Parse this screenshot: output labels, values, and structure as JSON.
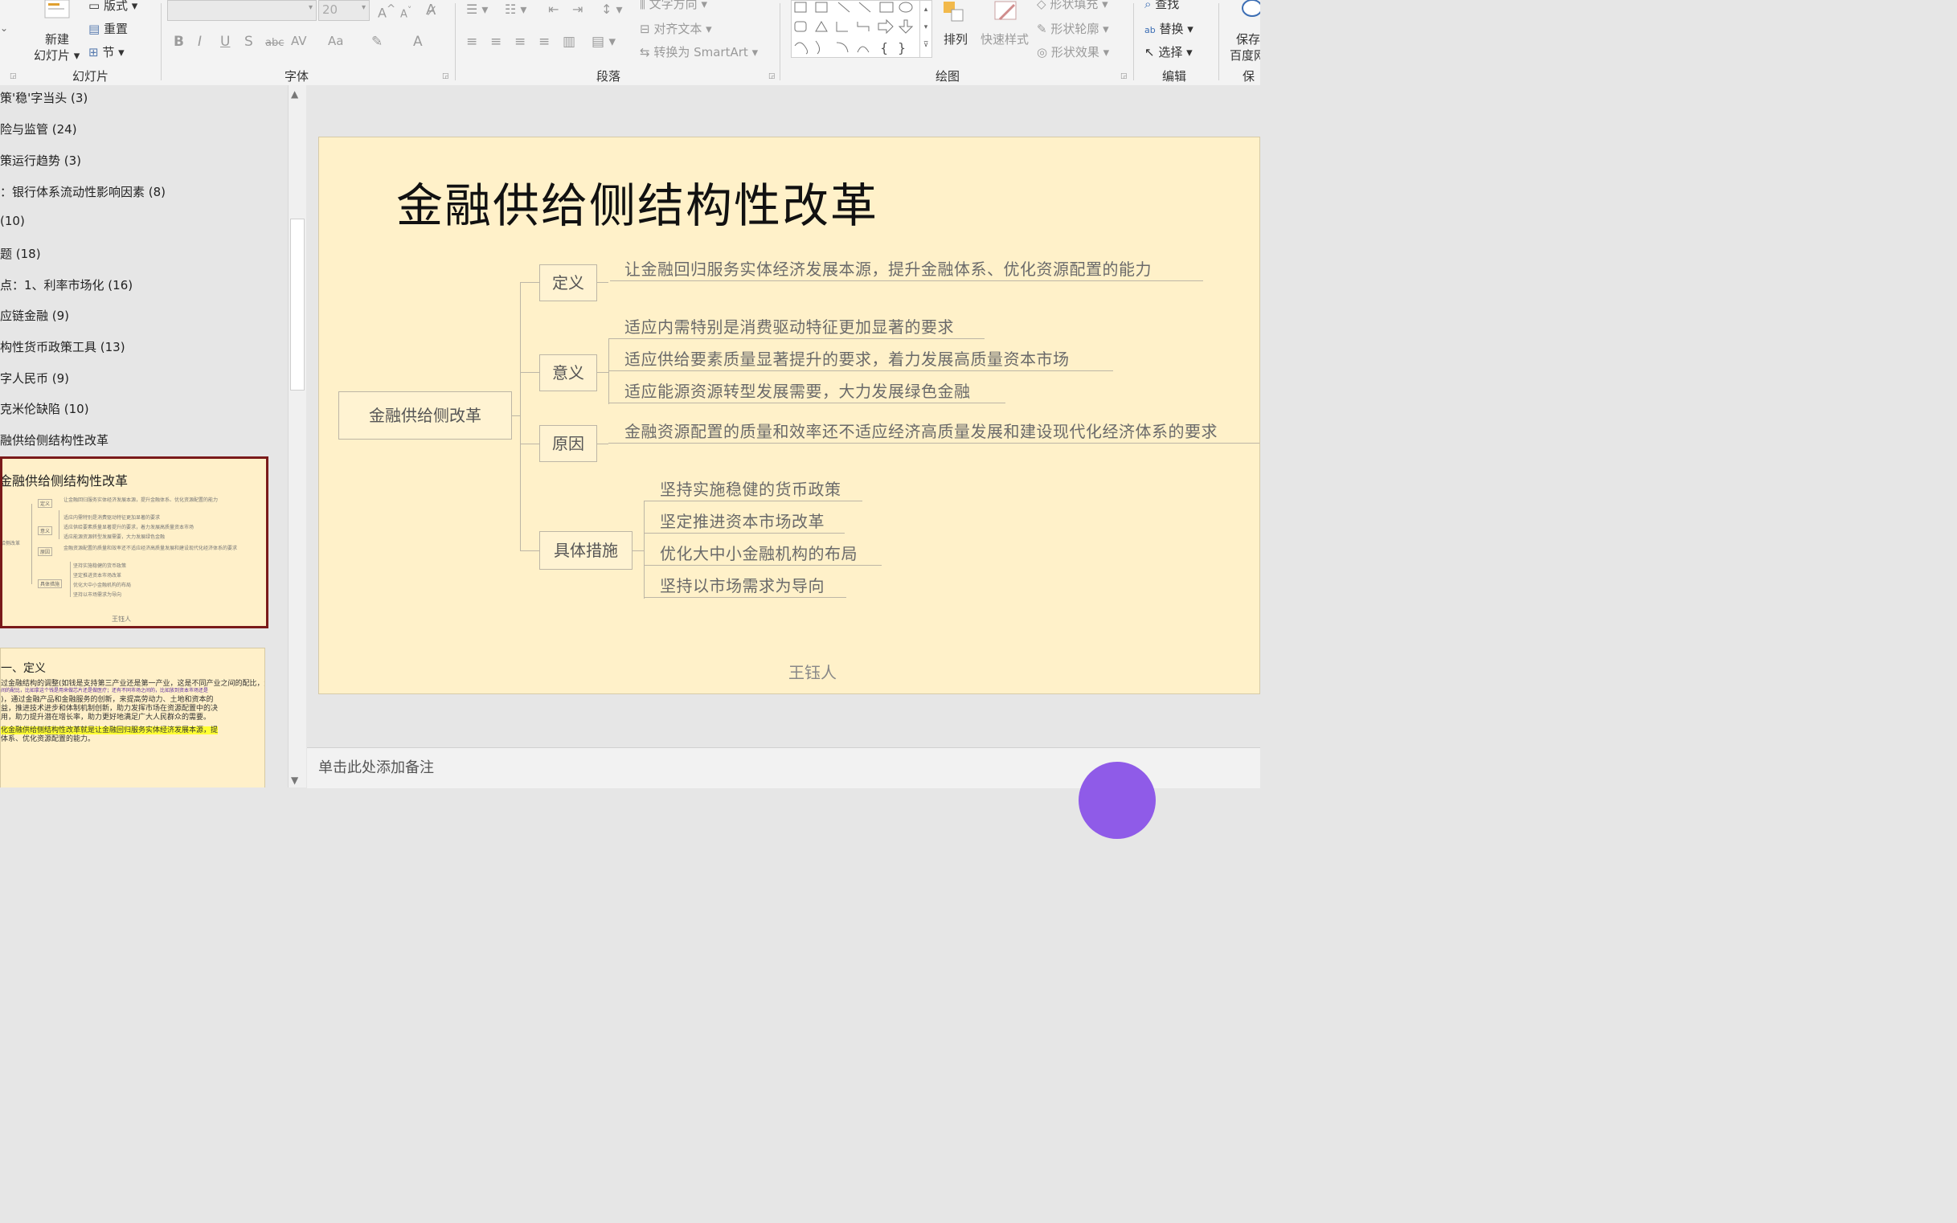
{
  "ribbon": {
    "slides_group": {
      "new_slide": "新建",
      "new_slide_line2": "幻灯片",
      "layout": "版式",
      "reset": "重置",
      "section": "节",
      "label": "幻灯片"
    },
    "font_group": {
      "font_name": "",
      "font_size": "20",
      "label": "字体",
      "buttons": [
        "B",
        "I",
        "U",
        "S",
        "abc",
        "AV",
        "Aa",
        "A"
      ]
    },
    "paragraph_group": {
      "text_direction": "文字方向",
      "align_text": "对齐文本",
      "convert_smartart": "转换为 SmartArt",
      "label": "段落"
    },
    "drawing_group": {
      "arrange": "排列",
      "quick_styles": "快速样式",
      "shape_fill": "形状填充",
      "shape_outline": "形状轮廓",
      "shape_effects": "形状效果",
      "label": "绘图"
    },
    "editing_group": {
      "find": "查找",
      "replace": "替换",
      "select": "选择",
      "label": "编辑"
    },
    "save_group": {
      "save_line1": "保存",
      "save_line2": "百度网",
      "label": "保存"
    }
  },
  "outline": [
    "策'稳'字当头 (3)",
    "险与监管 (24)",
    "策运行趋势 (3)",
    "：银行体系流动性影响因素 (8)",
    " (10)",
    "题 (18)",
    "点：1、利率市场化 (16)",
    "应链金融 (9)",
    "构性货币政策工具 (13)",
    "字人民币 (9)",
    "克米伦缺陷 (10)",
    "融供给侧结构性改革"
  ],
  "thumbnail_selected": {
    "title": "金融供给侧结构性改革",
    "root": "给侧改革",
    "boxes": [
      "定义",
      "意义",
      "原因",
      "具体措施"
    ],
    "lines": [
      "让金融回归服务实体经济发展本源，提升金融体系、优化资源配置的能力",
      "适应内需特别是消费驱动特征更加显著的要求",
      "适应供给要素质量显著提升的要求，着力发展高质量资本市场",
      "适应能源资源转型发展需要，大力发展绿色金融",
      "金融资源配置的质量和效率还不适应经济高质量发展和建设现代化经济体系的要求",
      "坚持实施稳健的货币政策",
      "坚定推进资本市场改革",
      "优化大中小金融机构的布局",
      "坚持以市场需求为导向"
    ],
    "author": "王钰人"
  },
  "thumbnail_next": {
    "title": "一、定义",
    "lines": [
      "过金融结构的调整(如钱是支持第三产业还是第一产业，这是不同产业之间的配比，还有不",
      "间的配比，比如拿这个钱是用来做芯片还是做医疗；还有不同市场之间的，比如放到资本市场还是",
      ")，通过金融产品和金融服务的创新，来提高劳动力、土地和资本的",
      "益，推进技术进步和体制机制创新，助力发挥市场在资源配置中的决",
      "用，助力提升潜在增长率，助力更好地满足广大人民群众的需要。",
      "化金融供给侧结构性改革就是让金融回归服务实体经济发展本源，提",
      "体系、优化资源配置的能力。"
    ]
  },
  "slide": {
    "title": "金融供给侧结构性改革",
    "root": "金融供给侧改革",
    "branches": [
      {
        "label": "定义",
        "items": [
          "让金融回归服务实体经济发展本源，提升金融体系、优化资源配置的能力"
        ]
      },
      {
        "label": "意义",
        "items": [
          "适应内需特别是消费驱动特征更加显著的要求",
          "适应供给要素质量显著提升的要求，着力发展高质量资本市场",
          "适应能源资源转型发展需要，大力发展绿色金融"
        ]
      },
      {
        "label": "原因",
        "items": [
          "金融资源配置的质量和效率还不适应经济高质量发展和建设现代化经济体系的要求"
        ]
      },
      {
        "label": "具体措施",
        "items": [
          "坚持实施稳健的货币政策",
          "坚定推进资本市场改革",
          "优化大中小金融机构的布局",
          "坚持以市场需求为导向"
        ]
      }
    ],
    "author": "王钰人"
  },
  "notes_placeholder": "单击此处添加备注"
}
